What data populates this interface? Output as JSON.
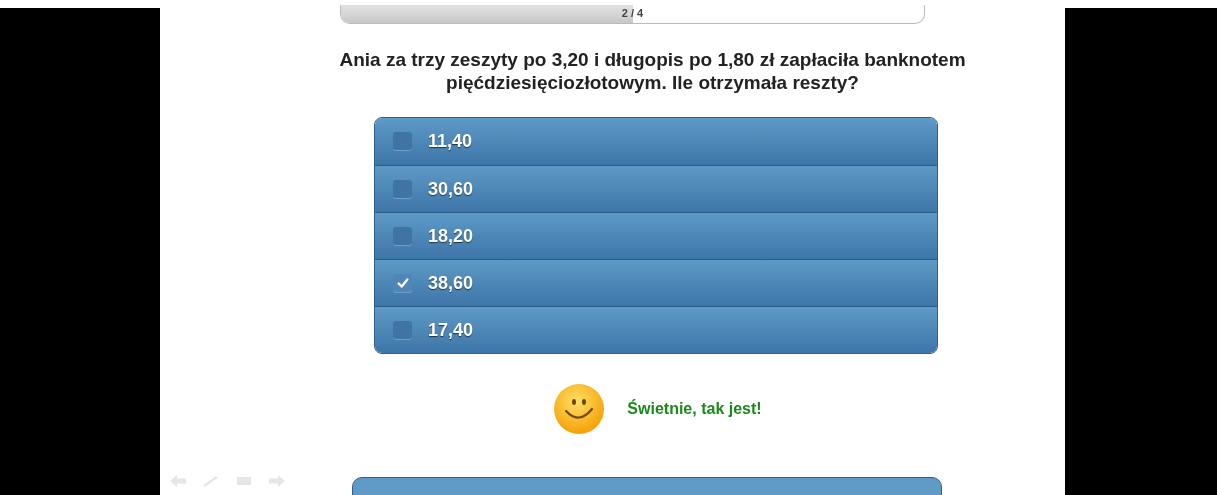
{
  "progress": {
    "label": "2 / 4",
    "level": 0.5
  },
  "question": "Ania za trzy zeszyty po 3,20 i długopis po 1,80 zł zapłaciła banknotem pięćdziesięciozłotowym. Ile otrzymała reszty?",
  "answers": [
    {
      "label": "11,40",
      "checked": false
    },
    {
      "label": "30,60",
      "checked": false
    },
    {
      "label": "18,20",
      "checked": false
    },
    {
      "label": "38,60",
      "checked": true
    },
    {
      "label": "17,40",
      "checked": false
    }
  ],
  "feedback": {
    "text": "Świetnie, tak jest!",
    "kind": "correct"
  }
}
